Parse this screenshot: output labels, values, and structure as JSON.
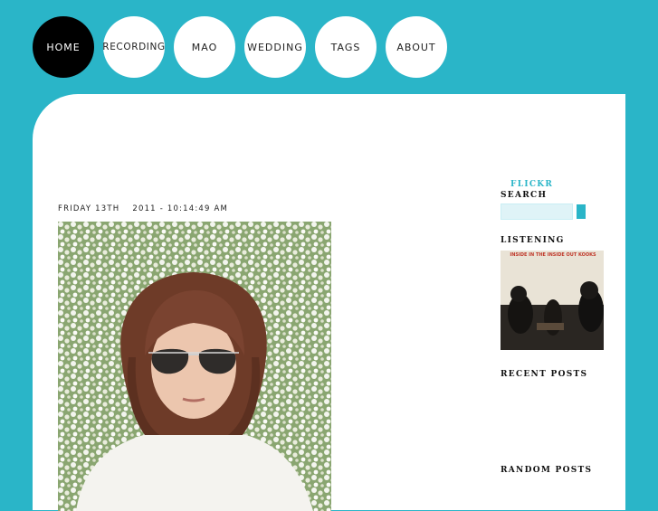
{
  "nav": {
    "items": [
      {
        "label": "HOME",
        "active": true
      },
      {
        "label": "RECORDING",
        "active": false
      },
      {
        "label": "MAO",
        "active": false
      },
      {
        "label": "WEDDING",
        "active": false
      },
      {
        "label": "TAGS",
        "active": false
      },
      {
        "label": "ABOUT",
        "active": false
      }
    ]
  },
  "post": {
    "date": "FRIDAY 13TH",
    "time": "2011 - 10:14:49 AM"
  },
  "sidebar": {
    "flickr_label": "FLICKR",
    "search_label": "SEARCH",
    "search_value": "",
    "listening_label": "LISTENING",
    "album_text": "INSIDE IN THE INSIDE OUT KOOKS",
    "recent_posts_label": "RECENT POSTS",
    "random_posts_label": "RANDOM POSTS"
  },
  "colors": {
    "background": "#2ab5c8",
    "accent": "#2ab5c8",
    "nav_active": "#000000",
    "card": "#ffffff"
  }
}
